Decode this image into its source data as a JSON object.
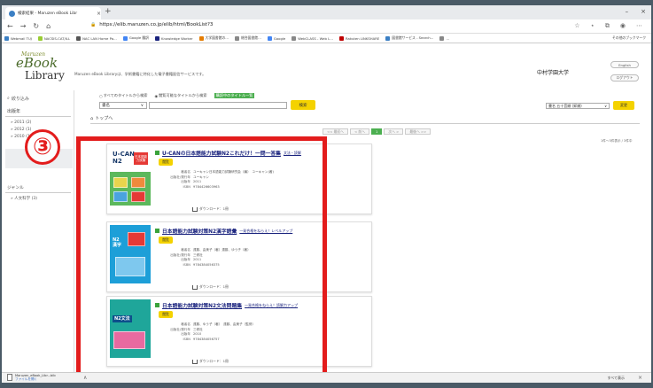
{
  "browser": {
    "tab_title": "検索結果 - Maruzen eBook Libr",
    "tab_close": "×",
    "new_tab": "+",
    "win_min": "–",
    "win_close": "×",
    "nav_back": "←",
    "nav_forward": "→",
    "nav_reload": "↻",
    "nav_home": "⌂",
    "url": "https://elib.maruzen.co.jp/elib/html/BookList?3",
    "addr_icons": [
      "☆",
      "⋆",
      "⧉",
      "◉",
      "⋯"
    ],
    "bookmarks": [
      {
        "label": "Webmail TUJ",
        "color": "#3b7fc4"
      },
      {
        "label": "NACSIS-CAT/ILL",
        "color": "#9c3"
      },
      {
        "label": "NAC LAN Home Pa…",
        "color": "#555"
      },
      {
        "label": "Google 翻訳",
        "color": "#4285f4"
      },
      {
        "label": "Knowledge Worker",
        "color": "#1a237e"
      },
      {
        "label": "大学図書館の…",
        "color": "#e57c00"
      },
      {
        "label": "総合図書館…",
        "color": "#888"
      },
      {
        "label": "Google",
        "color": "#4285f4"
      },
      {
        "label": "WebCLASS - Web L…",
        "color": "#888"
      },
      {
        "label": "Rakuten LINKSHARE",
        "color": "#bf0000"
      },
      {
        "label": "図書館サービス - Search…",
        "color": "#3b7fc4"
      },
      {
        "label": "…",
        "color": "#888"
      }
    ],
    "bookmarks_other": "その他のブックマーク"
  },
  "header": {
    "logo_maruzen": "Maruzen",
    "logo_ebook": "eBook",
    "logo_library": "Library",
    "description": "Maruzen eBook Libraryは、学術書籍に特化した電子書籍配信サービスです。",
    "university": "中村学園大学",
    "btn_english": "English",
    "btn_logout": "ログアウト"
  },
  "sidebar": {
    "search_icon": "⌕",
    "search_label": "絞り込み",
    "heading": "出版年",
    "years": [
      "» 2011 (2)",
      "» 2012 (1)",
      "» 2010 (1)"
    ],
    "selected_box": "",
    "genre_heading": "ジャンル",
    "genre_item": "» 人文科学 (3)"
  },
  "search": {
    "radio1": "すべてのタイトルから検索",
    "radio2": "閲覧可能なタイトルから検索",
    "radio3": "購読中のタイトル一覧",
    "field_select": "書名",
    "field_arrow": "∨",
    "search_btn": "検索",
    "sort_select": "書名 五十音順 (昇順)",
    "sort_arrow": "∨",
    "sort_btn": "変更"
  },
  "breadcrumb": {
    "icon": "⌂",
    "label": "トップへ"
  },
  "pager": {
    "first": "<< 最初へ",
    "prev": "< 前へ",
    "current": "1",
    "next": "次へ >",
    "last": "最後へ >>"
  },
  "count": "1件～3件表示 / 3件中",
  "books": [
    {
      "cover_text": "U-CAN\nN2",
      "cover_badge": "日本語能力試験",
      "title": "U-CANの日本語能力試験N2これだけ！一問一答集",
      "subtitle": "文法・読解",
      "read_btn": "閲覧",
      "meta": [
        {
          "k": "著者名",
          "v": "ユーキャン日本語能力試験研究会（編）　ユーキャン(著)"
        },
        {
          "k": "出版社/発行年",
          "v": "ユーキャン"
        },
        {
          "k": "出版年",
          "v": "2011"
        },
        {
          "k": "ISBN",
          "v": "9784426603963"
        }
      ],
      "download": "ダウンロード：1冊"
    },
    {
      "cover_text": "N2\n漢字",
      "cover_badge": "",
      "title": "日本語能力試験対策N2漢字語彙",
      "subtitle": "一発合格をねらえ！レベルアップ",
      "read_btn": "閲覧",
      "meta": [
        {
          "k": "著者名",
          "v": "遠藤、由美子（著）遠藤、ゆう子（著）"
        },
        {
          "k": "出版社/発行年",
          "v": "三修社"
        },
        {
          "k": "出版年",
          "v": "2011"
        },
        {
          "k": "ISBN",
          "v": "9784384056375"
        }
      ],
      "download": "ダウンロード：1冊"
    },
    {
      "cover_text": "N2文法",
      "cover_badge": "",
      "title": "日本語能力試験対策N2文法問題集",
      "subtitle": "一発合格をねらえ！読解力アップ",
      "read_btn": "閲覧",
      "meta": [
        {
          "k": "著者名",
          "v": "遠藤、ゆう子（著）　遠藤、由美子（監修）"
        },
        {
          "k": "出版社/発行年",
          "v": "三修社"
        },
        {
          "k": "出版年",
          "v": "2010"
        },
        {
          "k": "ISBN",
          "v": "9784384056757"
        }
      ],
      "download": "ダウンロード：1冊"
    }
  ],
  "annotation": {
    "step_number": "③"
  },
  "downloads": {
    "file_name": "Maruzen_eBook_Libr...bib",
    "file_link": "ファイルを開く",
    "more": "∧",
    "show_all": "すべて表示",
    "close": "×"
  }
}
